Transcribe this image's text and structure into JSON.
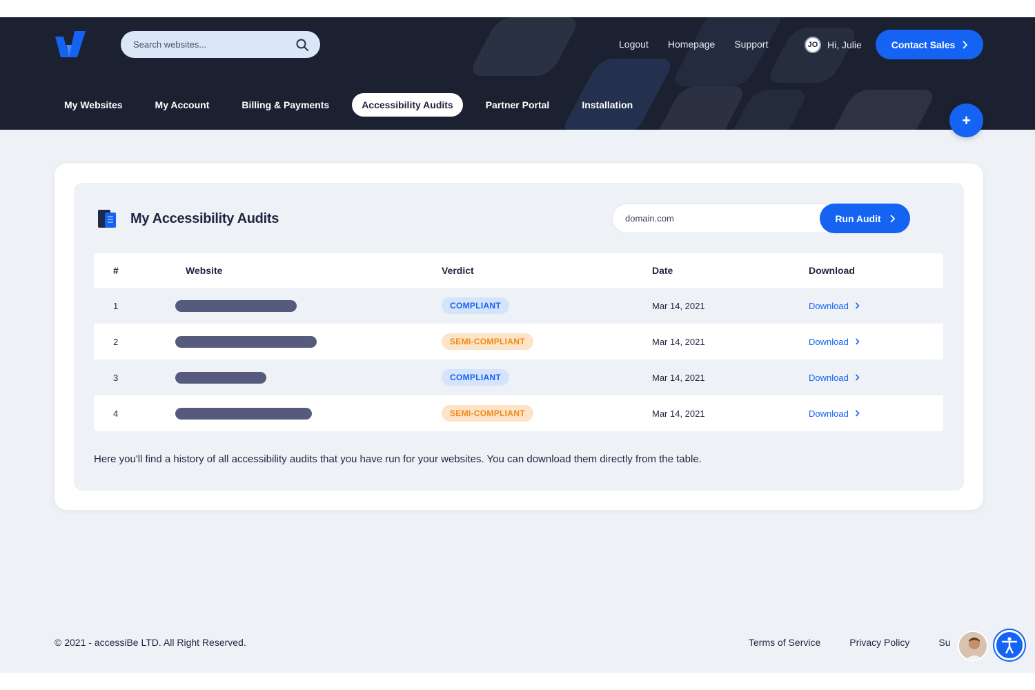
{
  "header": {
    "search_placeholder": "Search websites...",
    "top_links": [
      "Logout",
      "Homepage",
      "Support"
    ],
    "user_initials": "JO",
    "greeting": "Hi, Julie",
    "contact_label": "Contact Sales",
    "nav_tabs": [
      {
        "label": "My Websites",
        "active": false
      },
      {
        "label": "My Account",
        "active": false
      },
      {
        "label": "Billing & Payments",
        "active": false
      },
      {
        "label": "Accessibility Audits",
        "active": true
      },
      {
        "label": "Partner Portal",
        "active": false
      },
      {
        "label": "Installation",
        "active": false
      }
    ],
    "fab_label": "+"
  },
  "audits": {
    "title": "My Accessibility Audits",
    "domain_placeholder": "domain.com",
    "run_label": "Run Audit",
    "columns": [
      "#",
      "Website",
      "Verdict",
      "Date",
      "Download"
    ],
    "rows": [
      {
        "num": "1",
        "verdict": "COMPLIANT",
        "status": "compliant",
        "date": "Mar 14, 2021",
        "download": "Download",
        "blur_width": 0.8
      },
      {
        "num": "2",
        "verdict": "SEMI-COMPLIANT",
        "status": "semi",
        "date": "Mar 14, 2021",
        "download": "Download",
        "blur_width": 0.93
      },
      {
        "num": "3",
        "verdict": "COMPLIANT",
        "status": "compliant",
        "date": "Mar 14, 2021",
        "download": "Download",
        "blur_width": 0.6
      },
      {
        "num": "4",
        "verdict": "SEMI-COMPLIANT",
        "status": "semi",
        "date": "Mar 14, 2021",
        "download": "Download",
        "blur_width": 0.9
      }
    ],
    "note": "Here you'll find a history of all accessibility audits that you have run for your websites. You can download them directly from the table."
  },
  "footer": {
    "copyright": "© 2021 - accessiBe LTD. All Right Reserved.",
    "links": [
      "Terms of Service",
      "Privacy Policy",
      "Su"
    ]
  },
  "colors": {
    "header_bg": "#1b2130",
    "accent": "#1463f3",
    "page_bg": "#eef2f6",
    "compliant_bg": "#d5e3fb",
    "semi_bg": "#fde3c7",
    "semi_text": "#f08a16"
  },
  "icons": {
    "logo": "brand-logo",
    "search": "search-icon",
    "chevron": "chevron-right-icon",
    "audits": "book-icon",
    "accessibility": "accessibility-icon"
  }
}
